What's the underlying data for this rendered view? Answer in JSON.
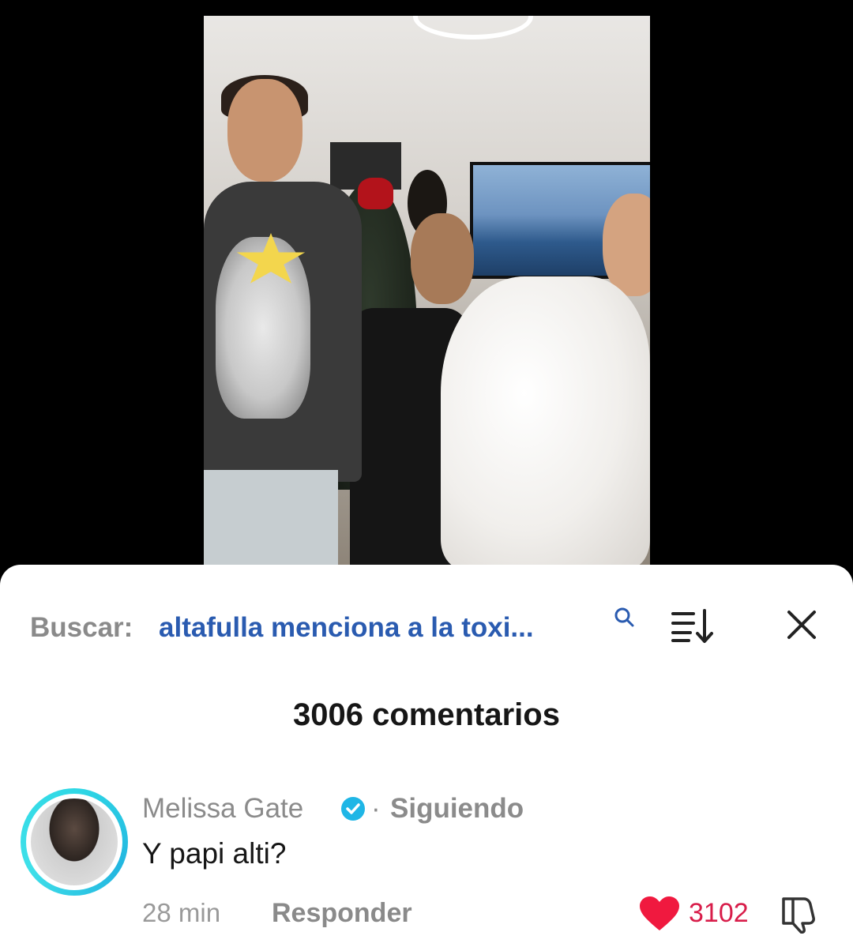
{
  "search": {
    "label": "Buscar:",
    "query": "altafulla menciona a la toxi..."
  },
  "comments_header": {
    "count_text": "3006 comentarios"
  },
  "comment": {
    "author": "Melissa Gate",
    "separator": "·",
    "following": "Siguiendo",
    "text": "Y papi alti?",
    "time": "28 min",
    "reply_label": "Responder",
    "likes": "3102"
  },
  "colors": {
    "search_query": "#2a5bb0",
    "like_heart": "#f0193f",
    "avatar_ring": "#2fd8e5",
    "verified": "#1fb6e6"
  },
  "icons": [
    "search-icon",
    "sort-icon",
    "close-icon",
    "verified-icon",
    "heart-icon",
    "dislike-icon"
  ]
}
